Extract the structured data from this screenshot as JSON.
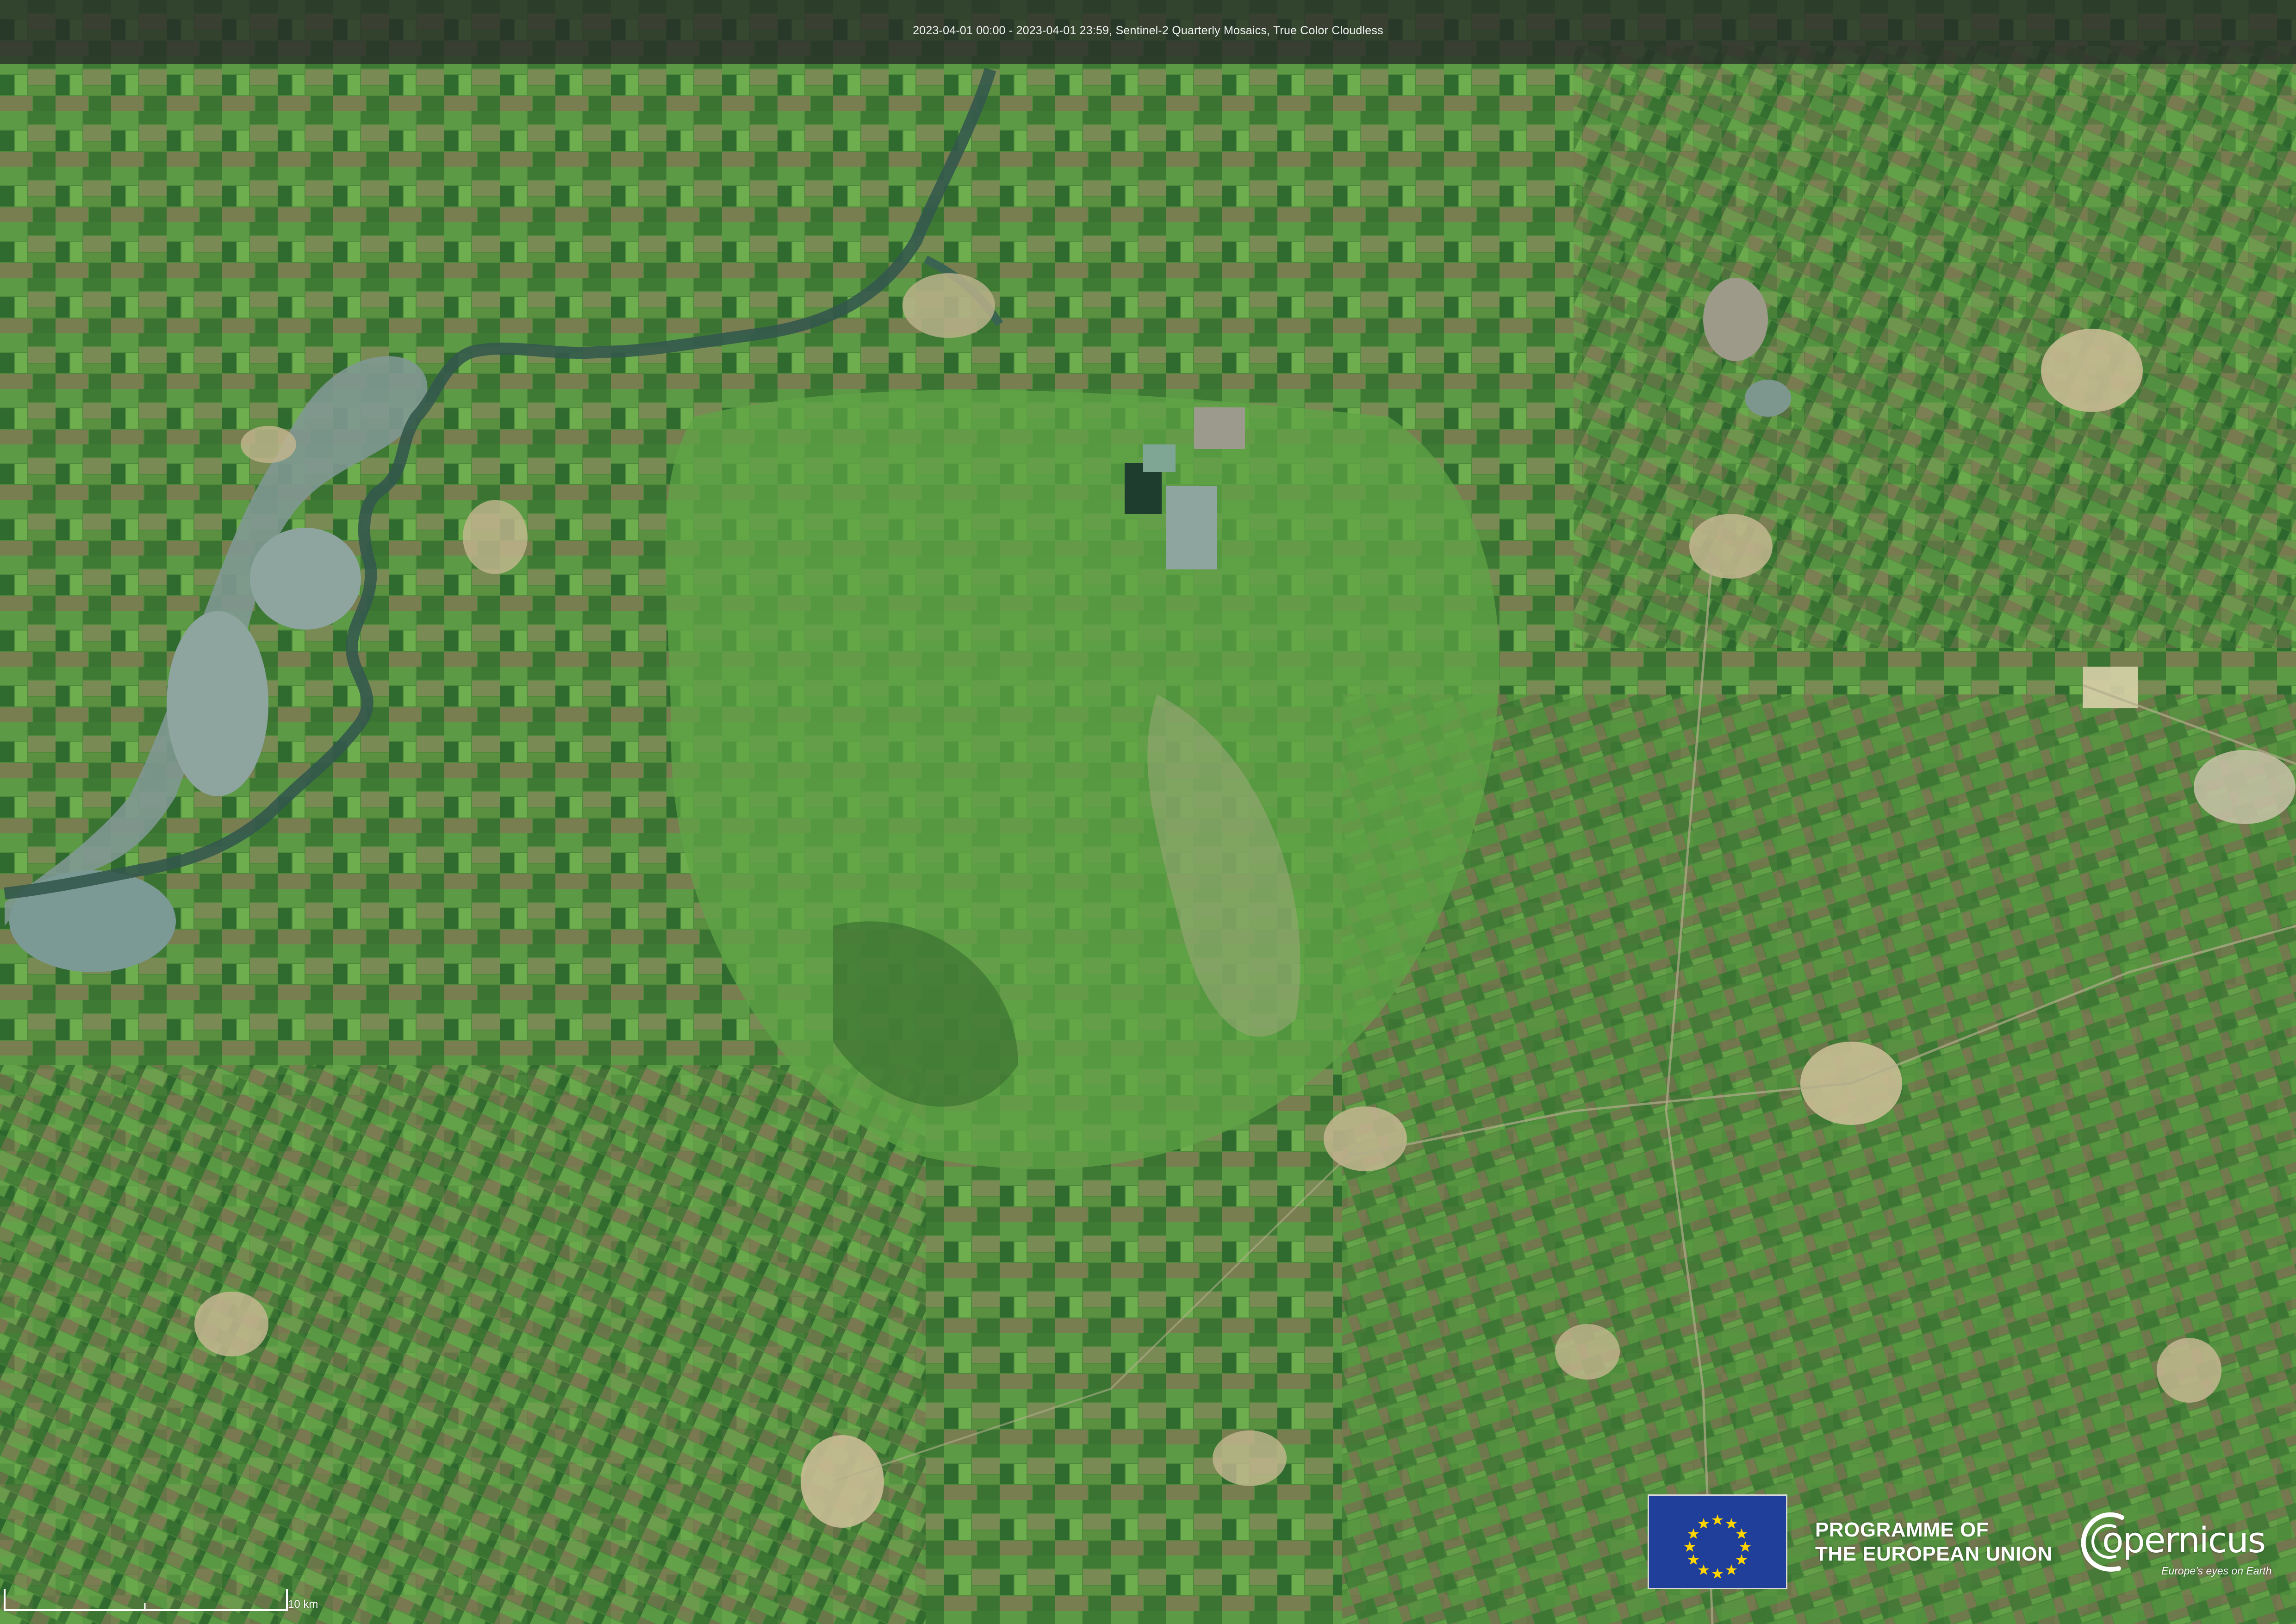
{
  "header": {
    "caption": "2023-04-01 00:00 - 2023-04-01 23:59, Sentinel-2 Quarterly Mosaics, True Color Cloudless"
  },
  "scale": {
    "label": "10 km"
  },
  "eu": {
    "line1": "PROGRAMME OF",
    "line2": "THE EUROPEAN UNION",
    "flag_icon": "eu-flag-icon"
  },
  "copernicus": {
    "name": "opernicus",
    "tagline": "Europe's eyes on Earth",
    "logo_icon": "copernicus-logo-icon"
  },
  "colors": {
    "field_green": "#4f8a3c",
    "dark_green": "#2f5e2a",
    "light_green": "#6fae4e",
    "field_brown": "#8a7a5a",
    "water": "#8fa3a0",
    "river": "#3a5f55",
    "town": "#c9bc95",
    "header_bg": "#262c28",
    "eu_blue": "#1f3f9b",
    "eu_star": "#ffd400"
  }
}
